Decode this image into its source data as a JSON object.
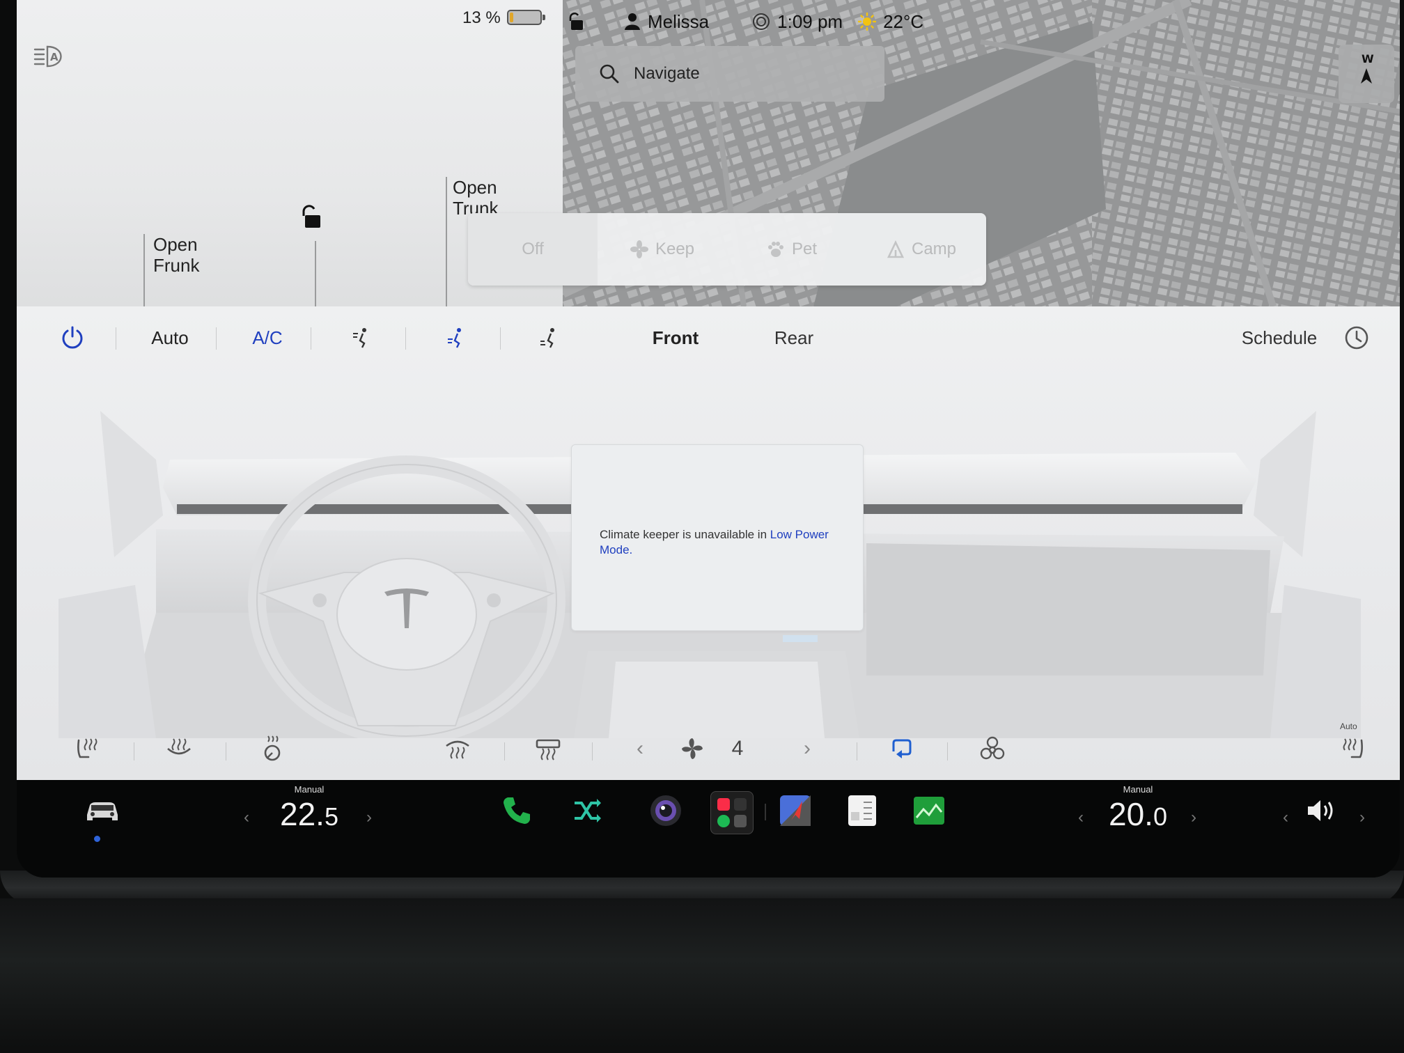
{
  "status": {
    "battery_percent": "13 %",
    "battery_level": 0.13,
    "user": "Melissa",
    "time": "1:09 pm",
    "temperature": "22°C"
  },
  "car": {
    "frunk_line1": "Open",
    "frunk_line2": "Frunk",
    "trunk_line1": "Open",
    "trunk_line2": "Trunk"
  },
  "map": {
    "navigate_placeholder": "Navigate",
    "compass": "W"
  },
  "keep_popup": {
    "options": [
      "Off",
      "Keep",
      "Pet",
      "Camp"
    ],
    "selected": "Off"
  },
  "climate": {
    "auto_label": "Auto",
    "ac_label": "A/C",
    "front_label": "Front",
    "rear_label": "Rear",
    "schedule_label": "Schedule",
    "message_text": "Climate keeper is unavailable in ",
    "message_link": "Low Power Mode.",
    "fan_speed": "4",
    "auto_small": "Auto"
  },
  "taskbar": {
    "left_temp_mode": "Manual",
    "left_temp_int": "22.",
    "left_temp_dec": "5",
    "right_temp_mode": "Manual",
    "right_temp_int": "20.",
    "right_temp_dec": "0"
  },
  "colors": {
    "accent_blue": "#1f3fbf",
    "battery_low": "#e0a62a",
    "phone_green": "#22b14c"
  },
  "icons": {
    "headlight": "auto-headlight-icon",
    "lock": "unlocked-padlock-icon",
    "power": "power-icon",
    "clock": "clock-icon",
    "fan": "fan-icon",
    "recirculate": "recirculate-icon",
    "biohazard": "bioweapon-defense-icon",
    "volume": "volume-icon"
  }
}
